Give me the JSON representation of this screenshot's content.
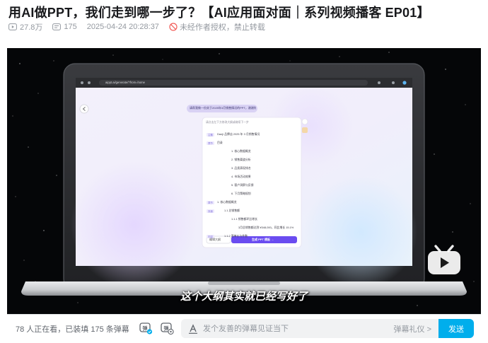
{
  "video": {
    "title": "用AI做PPT，我们走到哪一步了？【AI应用面对面｜系列视频播客 EP01】",
    "play_count": "27.8万",
    "danmaku_count": "175",
    "publish_time": "2025-04-24 20:28:37",
    "copyright_notice": "未经作者授权，禁止转载"
  },
  "player": {
    "subtitle": "这个大纲其实就已经写好了",
    "screen": {
      "url": "aippt.ai/generate/?from=home",
      "prompt_bubble": "请帮我做一份关于2025年3月销售情况的PPT，谢谢你啦！",
      "panel_header": "请点击左下方修改大纲或继续下一步",
      "outline": [
        {
          "tag": "主题",
          "text": "Danjì 品牌店 2025 年 3 月销售情况",
          "indent": 0
        },
        {
          "tag": "章节",
          "text": "目录",
          "indent": 0
        },
        {
          "tag": "",
          "text": "1. 核心数据概览",
          "indent": 2
        },
        {
          "tag": "",
          "text": "2. 销售渠道分析",
          "indent": 2
        },
        {
          "tag": "",
          "text": "3. 品类表现排名",
          "indent": 2
        },
        {
          "tag": "",
          "text": "4. 市场活动效果",
          "indent": 2
        },
        {
          "tag": "",
          "text": "5. 客户洞察与反馈",
          "indent": 2
        },
        {
          "tag": "",
          "text": "6. 下月策略规划",
          "indent": 2
        },
        {
          "tag": "章节",
          "text": "1. 核心数据概览",
          "indent": 0
        },
        {
          "tag": "页面",
          "text": "1.1 总销售额",
          "indent": 1
        },
        {
          "tag": "",
          "text": "1.1.1 销售额环比增长",
          "indent": 2
        },
        {
          "tag": "",
          "text": "3月总销售额达到 ¥348,000，同比增长 15.1%",
          "indent": 3
        },
        {
          "tag": "内容",
          "text": "1.1.2 客单价与件数",
          "indent": 1
        }
      ],
      "edit_button": "编辑大纲",
      "generate_button": "生成 PPT 模板  →"
    }
  },
  "bottom_bar": {
    "viewers_text": "78 人正在看，已装填 175 条弹幕",
    "danmaku_placeholder": "发个友善的弹幕见证当下",
    "etiquette_label": "弹幕礼仪 >",
    "send_label": "发送"
  },
  "colors": {
    "accent": "#00aeec",
    "generate_button": "#6a4cf0",
    "text_secondary": "#9499a0"
  },
  "icons": {
    "play_count": "play-count-icon",
    "danmaku_count": "danmaku-count-icon",
    "no_reprint": "no-reprint-icon",
    "danmaku_toggle": "danmaku-toggle-icon",
    "danmaku_setting": "danmaku-setting-icon",
    "danmaku_style": "text-style-icon",
    "watermark": "bilibili-tv-logo-icon"
  }
}
